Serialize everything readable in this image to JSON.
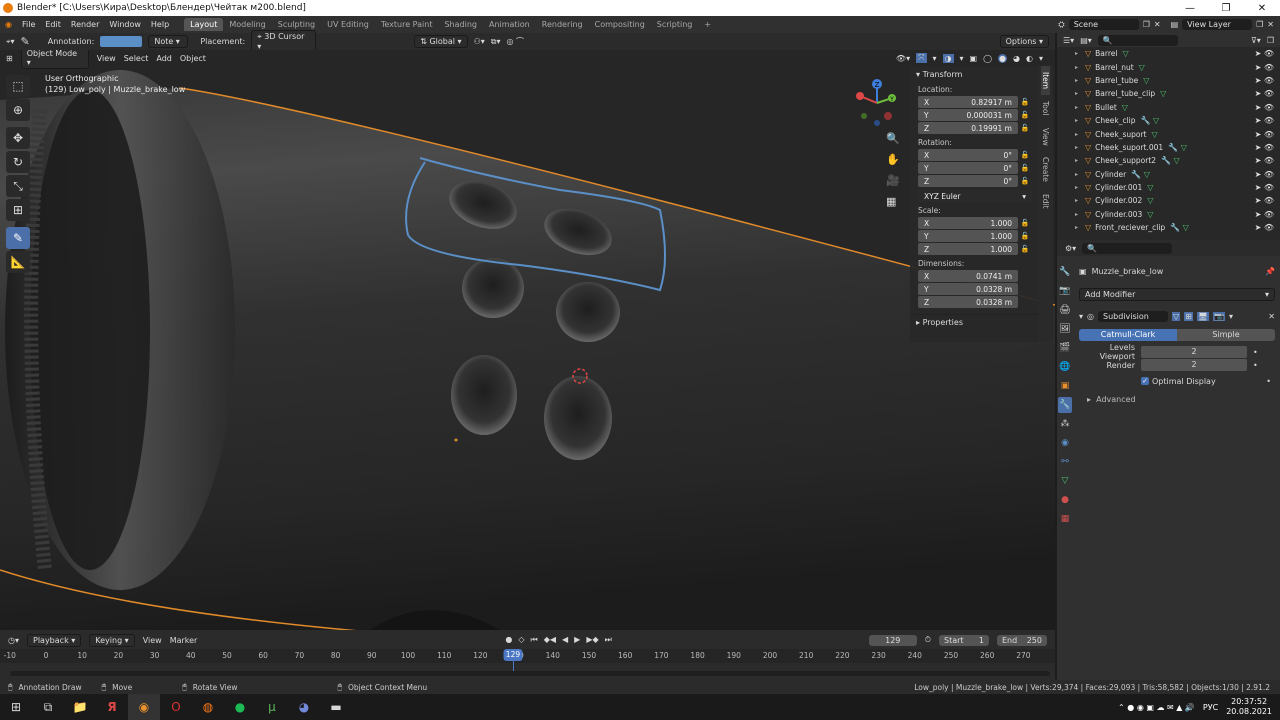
{
  "title_bar": {
    "title": "Blender* [C:\\Users\\Кира\\Desktop\\Блендер\\Чейтак м200.blend]",
    "controls": [
      "—",
      "❐",
      "✕"
    ]
  },
  "menu": {
    "items": [
      "File",
      "Edit",
      "Render",
      "Window",
      "Help"
    ]
  },
  "workspaces": [
    "Layout",
    "Modeling",
    "Sculpting",
    "UV Editing",
    "Texture Paint",
    "Shading",
    "Animation",
    "Rendering",
    "Compositing",
    "Scripting"
  ],
  "active_workspace": "Layout",
  "scene": "Scene",
  "view_layer": "View Layer",
  "tool_header": {
    "annotation_label": "Annotation:",
    "annotation_color": "#5b8fc7",
    "note": "Note",
    "placement_label": "Placement:",
    "placement": "3D Cursor",
    "orientation": "Global",
    "options": "Options"
  },
  "viewport": {
    "mode": "Object Mode",
    "menus": [
      "View",
      "Select",
      "Add",
      "Object"
    ],
    "view_name": "User Orthographic",
    "object_info": "(129)  Low_poly | Muzzle_brake_low",
    "gizmo_axes": [
      "X",
      "Y",
      "Z"
    ]
  },
  "npanel": {
    "section": "Transform",
    "location_label": "Location:",
    "location": [
      {
        "axis": "X",
        "value": "0.82917 m"
      },
      {
        "axis": "Y",
        "value": "0.000031 m"
      },
      {
        "axis": "Z",
        "value": "0.19991 m"
      }
    ],
    "rotation_label": "Rotation:",
    "rotation": [
      {
        "axis": "X",
        "value": "0°"
      },
      {
        "axis": "Y",
        "value": "0°"
      },
      {
        "axis": "Z",
        "value": "0°"
      }
    ],
    "rotation_mode": "XYZ Euler",
    "scale_label": "Scale:",
    "scale": [
      {
        "axis": "X",
        "value": "1.000"
      },
      {
        "axis": "Y",
        "value": "1.000"
      },
      {
        "axis": "Z",
        "value": "1.000"
      }
    ],
    "dimensions_label": "Dimensions:",
    "dimensions": [
      {
        "axis": "X",
        "value": "0.0741 m"
      },
      {
        "axis": "Y",
        "value": "0.0328 m"
      },
      {
        "axis": "Z",
        "value": "0.0328 m"
      }
    ],
    "properties": "Properties",
    "tabs": [
      "Item",
      "Tool",
      "View",
      "Create",
      "Edit"
    ]
  },
  "outliner": {
    "items": [
      {
        "name": "Barrel",
        "mods": 1
      },
      {
        "name": "Barrel_nut",
        "mods": 1
      },
      {
        "name": "Barrel_tube",
        "mods": 1
      },
      {
        "name": "Barrel_tube_clip",
        "mods": 1
      },
      {
        "name": "Bullet",
        "mods": 1
      },
      {
        "name": "Cheek_clip",
        "mods": 2
      },
      {
        "name": "Cheek_suport",
        "mods": 1
      },
      {
        "name": "Cheek_suport.001",
        "mods": 2
      },
      {
        "name": "Cheek_support2",
        "mods": 2
      },
      {
        "name": "Cylinder",
        "mods": 2
      },
      {
        "name": "Cylinder.001",
        "mods": 1
      },
      {
        "name": "Cylinder.002",
        "mods": 1
      },
      {
        "name": "Cylinder.003",
        "mods": 1
      },
      {
        "name": "Front_reciever_clip",
        "mods": 2
      }
    ]
  },
  "properties": {
    "object_name": "Muzzle_brake_low",
    "add_modifier": "Add Modifier",
    "modifier_name": "Subdivision",
    "mode_catmull": "Catmull-Clark",
    "mode_simple": "Simple",
    "levels_label": "Levels Viewport",
    "levels_value": "2",
    "render_label": "Render",
    "render_value": "2",
    "optimal_display": "Optimal Display",
    "advanced": "Advanced"
  },
  "timeline": {
    "menus": [
      "Playback",
      "Keying",
      "View",
      "Marker"
    ],
    "current_frame": "129",
    "start_label": "Start",
    "start": "1",
    "end_label": "End",
    "end": "250",
    "ticks": [
      "-10",
      "0",
      "10",
      "20",
      "30",
      "40",
      "50",
      "60",
      "70",
      "80",
      "90",
      "100",
      "110",
      "120",
      "130",
      "140",
      "150",
      "160",
      "170",
      "180",
      "190",
      "200",
      "210",
      "220",
      "230",
      "240",
      "250",
      "260",
      "270"
    ]
  },
  "statusbar": {
    "left1": "Annotation Draw",
    "left2": "Move",
    "left3": "Rotate View",
    "left4": "Object Context Menu",
    "right": "Low_poly | Muzzle_brake_low | Verts:29,374 | Faces:29,093 | Tris:58,582 | Objects:1/30 | 2.91.2"
  },
  "taskbar": {
    "lang": "РУС",
    "time": "20:37:52",
    "date": "20.08.2021"
  }
}
